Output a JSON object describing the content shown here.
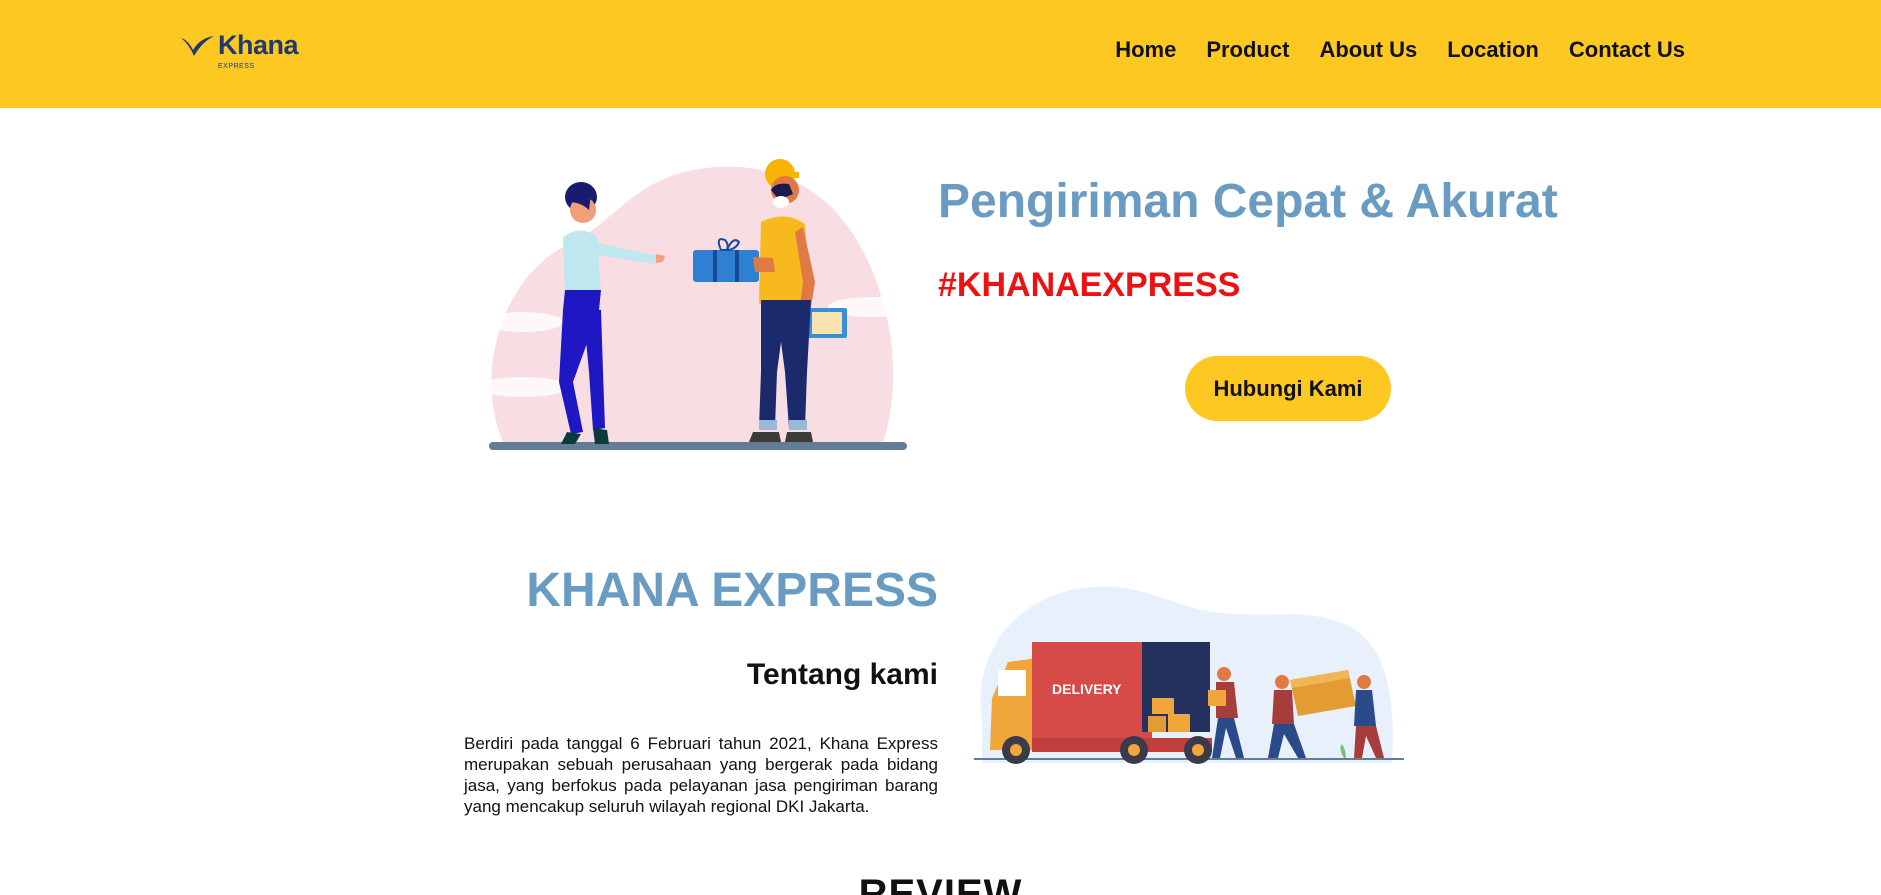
{
  "brand": {
    "name": "Khana",
    "tagline": "EXPRESS",
    "primary_color": "#fec823",
    "accent_blue": "#6a9cc3",
    "hashtag_red": "#ee1111"
  },
  "nav": {
    "items": [
      {
        "label": "Home"
      },
      {
        "label": "Product"
      },
      {
        "label": "About Us"
      },
      {
        "label": "Location"
      },
      {
        "label": "Contact Us"
      }
    ]
  },
  "hero": {
    "title": "Pengiriman Cepat & Akurat",
    "hashtag": "#KHANAEXPRESS",
    "cta_label": "Hubungi Kami"
  },
  "about": {
    "title": "KHANA EXPRESS",
    "subtitle": "Tentang kami",
    "body": "Berdiri pada tanggal 6 Februari tahun 2021, Khana Express merupakan sebuah perusahaan yang bergerak pada bidang jasa, yang berfokus pada pelayanan jasa pengiriman barang yang mencakup seluruh wilayah regional DKI Jakarta.",
    "truck_label": "DELIVERY"
  },
  "review": {
    "heading": "REVIEW"
  }
}
